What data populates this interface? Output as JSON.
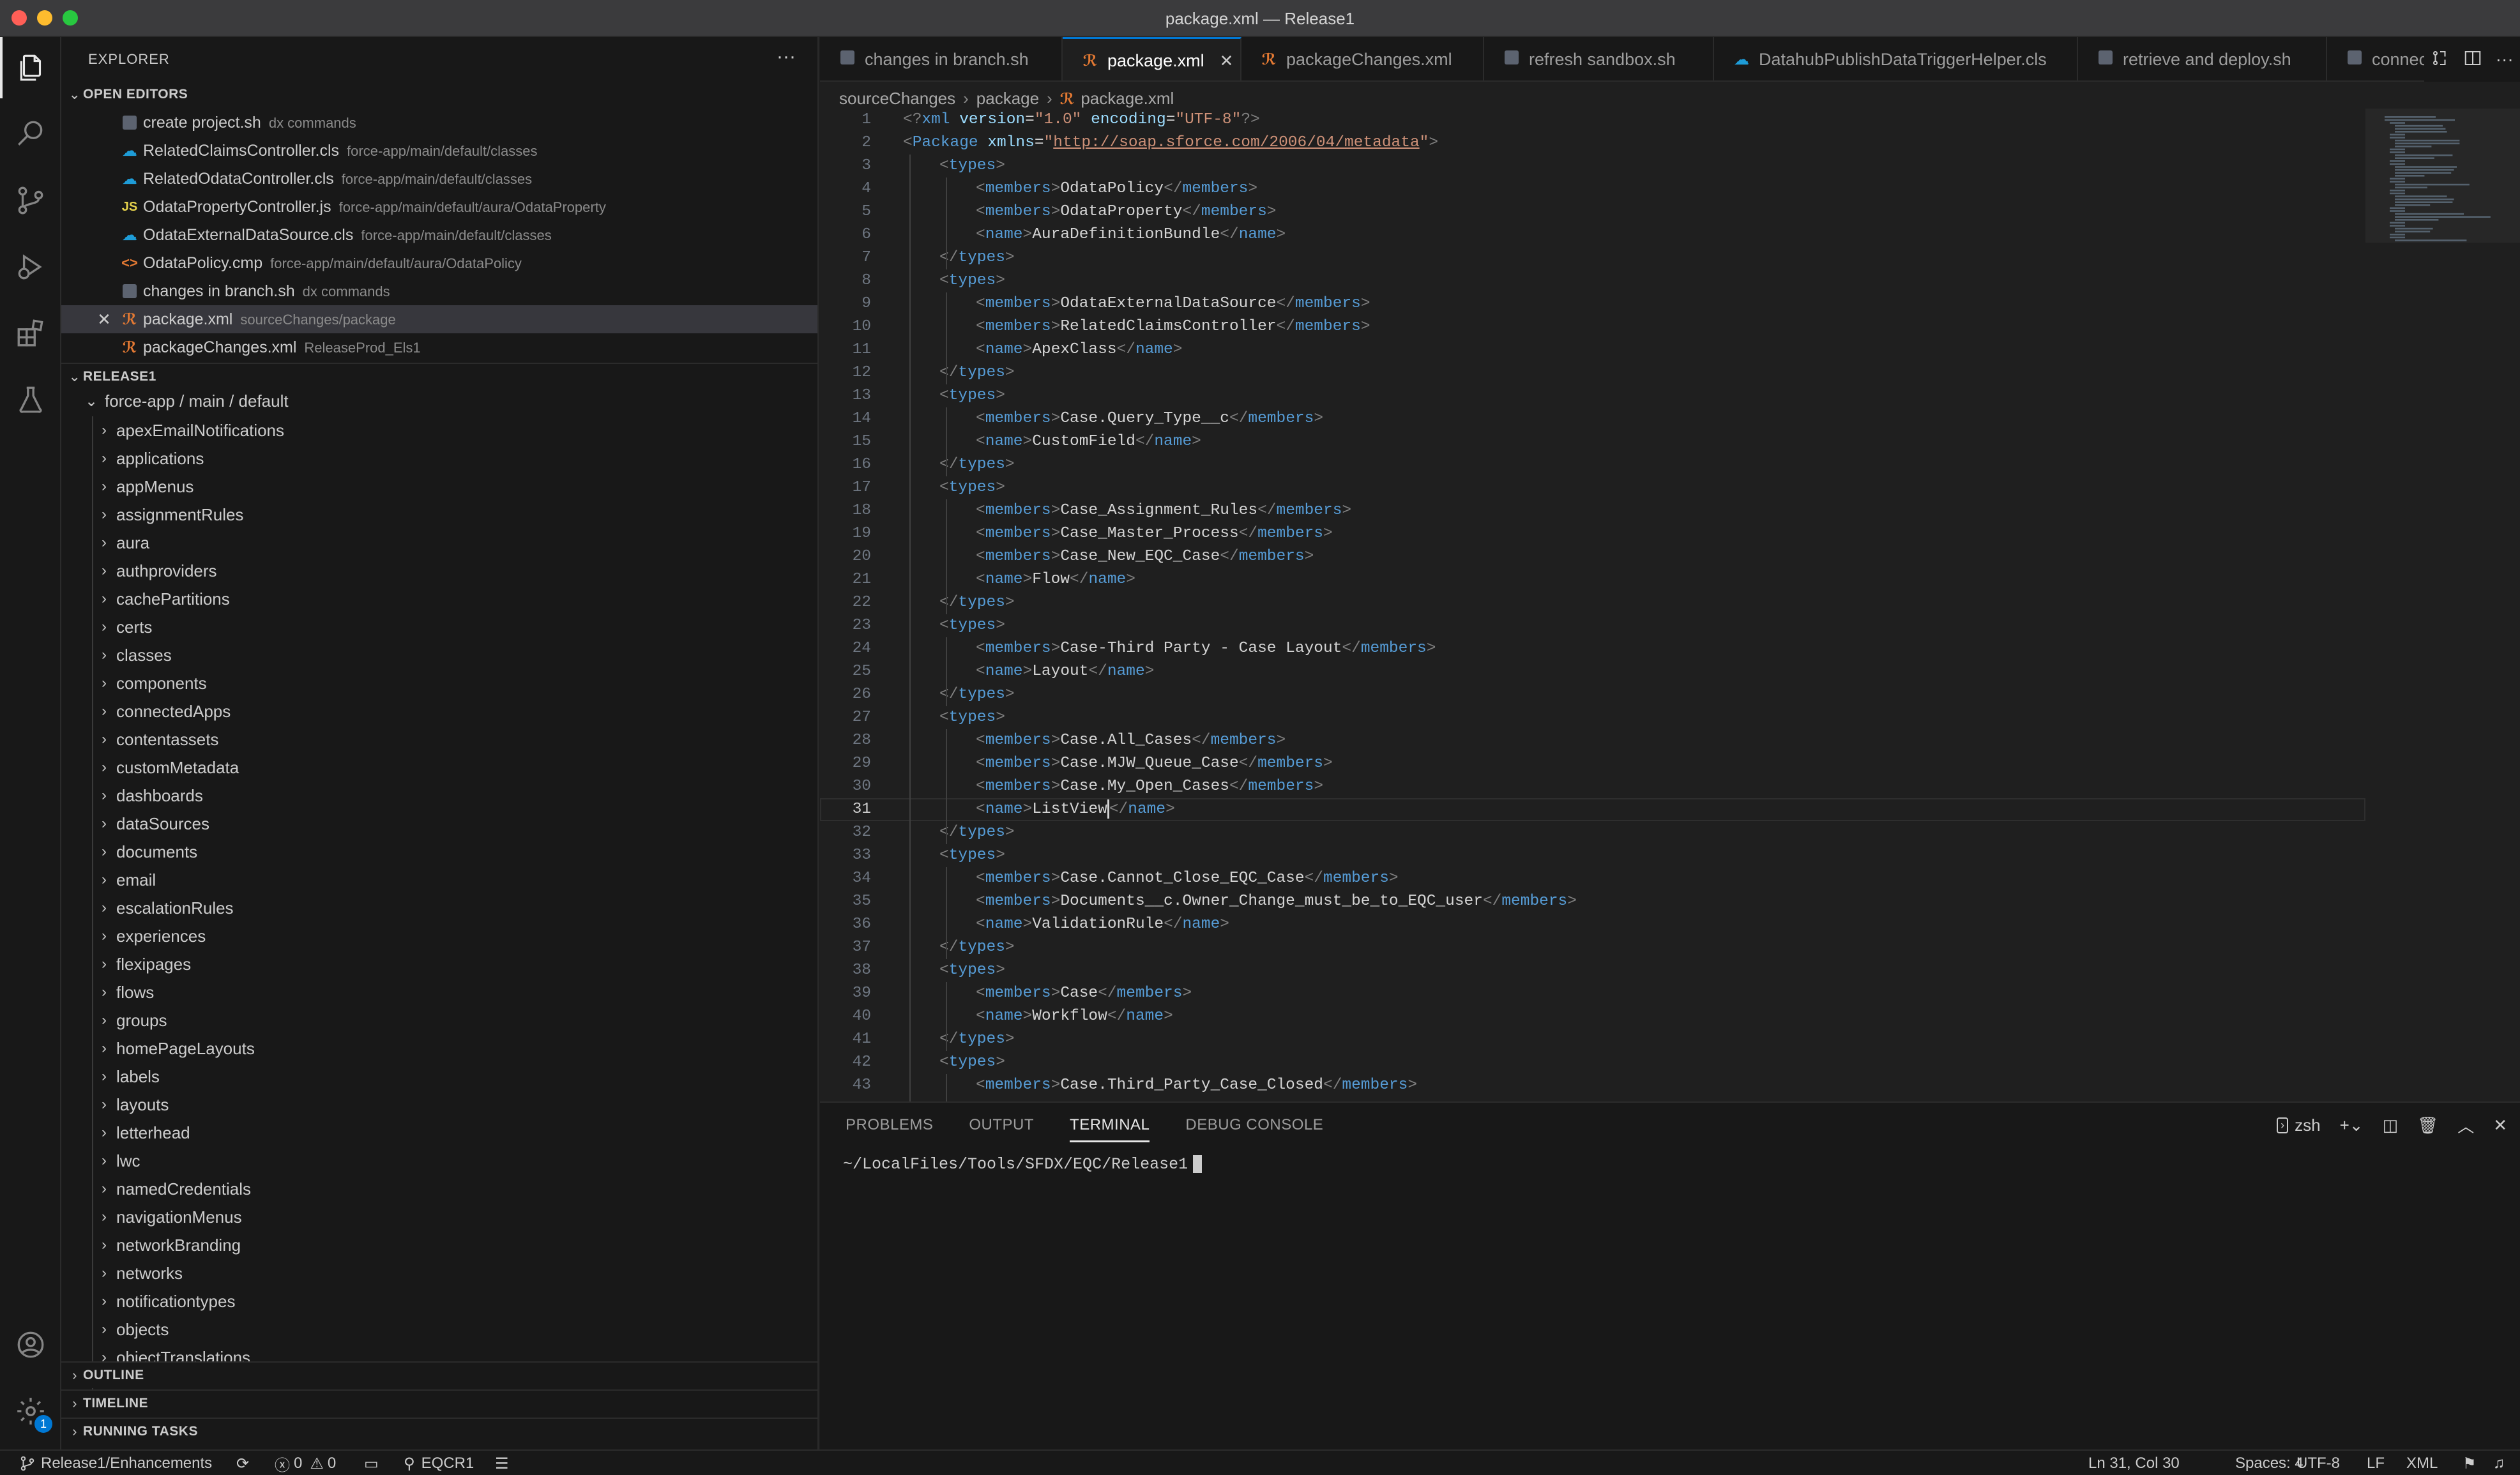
{
  "window": {
    "title": "package.xml — Release1"
  },
  "colors": {
    "accent": "#0078d4",
    "traffic_close": "#ff5f57",
    "traffic_min": "#febc2e",
    "traffic_max": "#28c840"
  },
  "activity_bar": {
    "items": [
      {
        "name": "explorer-icon",
        "active": true
      },
      {
        "name": "search-icon"
      },
      {
        "name": "source-control-icon"
      },
      {
        "name": "run-debug-icon"
      },
      {
        "name": "extensions-icon"
      },
      {
        "name": "testing-icon"
      }
    ],
    "bottom": [
      {
        "name": "accounts-icon"
      },
      {
        "name": "manage-gear-icon",
        "badge": "1"
      }
    ]
  },
  "explorer": {
    "title": "EXPLORER",
    "more": "···",
    "open_editors": {
      "label": "OPEN EDITORS",
      "items": [
        {
          "name": "create project.sh",
          "desc": "dx commands",
          "icon": "shell"
        },
        {
          "name": "RelatedClaimsController.cls",
          "desc": "force-app/main/default/classes",
          "icon": "salesforce"
        },
        {
          "name": "RelatedOdataController.cls",
          "desc": "force-app/main/default/classes",
          "icon": "salesforce"
        },
        {
          "name": "OdataPropertyController.js",
          "desc": "force-app/main/default/aura/OdataProperty",
          "icon": "js"
        },
        {
          "name": "OdataExternalDataSource.cls",
          "desc": "force-app/main/default/classes",
          "icon": "salesforce"
        },
        {
          "name": "OdataPolicy.cmp",
          "desc": "force-app/main/default/aura/OdataPolicy",
          "icon": "cmp"
        },
        {
          "name": "changes in branch.sh",
          "desc": "dx commands",
          "icon": "shell"
        },
        {
          "name": "package.xml",
          "desc": "sourceChanges/package",
          "icon": "rss",
          "selected": true,
          "close": "✕"
        },
        {
          "name": "packageChanges.xml",
          "desc": "ReleaseProd_Els1",
          "icon": "rss"
        }
      ]
    },
    "workspace": {
      "label": "RELEASE1",
      "root": "force-app / main / default",
      "folders": [
        "apexEmailNotifications",
        "applications",
        "appMenus",
        "assignmentRules",
        "aura",
        "authproviders",
        "cachePartitions",
        "certs",
        "classes",
        "components",
        "connectedApps",
        "contentassets",
        "customMetadata",
        "dashboards",
        "dataSources",
        "documents",
        "email",
        "escalationRules",
        "experiences",
        "flexipages",
        "flows",
        "groups",
        "homePageLayouts",
        "labels",
        "layouts",
        "letterhead",
        "lwc",
        "namedCredentials",
        "navigationMenus",
        "networkBranding",
        "networks",
        "notificationtypes",
        "objects",
        "objectTranslations"
      ]
    },
    "outline_label": "OUTLINE",
    "timeline_label": "TIMELINE",
    "running_tasks_label": "RUNNING TASKS"
  },
  "editor": {
    "tabs": [
      {
        "label": "changes in branch.sh",
        "icon": "shell"
      },
      {
        "label": "package.xml",
        "icon": "rss",
        "active": true,
        "close": "✕"
      },
      {
        "label": "packageChanges.xml",
        "icon": "rss"
      },
      {
        "label": "refresh sandbox.sh",
        "icon": "shell"
      },
      {
        "label": "DatahubPublishDataTriggerHelper.cls",
        "icon": "salesforce"
      },
      {
        "label": "retrieve and deploy.sh",
        "icon": "shell"
      },
      {
        "label": "connec",
        "icon": "shell"
      }
    ],
    "breadcrumb": [
      "sourceChanges",
      "package",
      "package.xml"
    ],
    "current_line": 31,
    "lines": [
      {
        "n": 1,
        "i": 0,
        "kind": "decl",
        "text": "<?xml version=\"1.0\" encoding=\"UTF-8\"?>"
      },
      {
        "n": 2,
        "i": 0,
        "kind": "pkg",
        "text": "<Package xmlns=\"http://soap.sforce.com/2006/04/metadata\">"
      },
      {
        "n": 3,
        "i": 1,
        "kind": "open",
        "tag": "types"
      },
      {
        "n": 4,
        "i": 2,
        "kind": "el",
        "tag": "members",
        "val": "OdataPolicy"
      },
      {
        "n": 5,
        "i": 2,
        "kind": "el",
        "tag": "members",
        "val": "OdataProperty"
      },
      {
        "n": 6,
        "i": 2,
        "kind": "el",
        "tag": "name",
        "val": "AuraDefinitionBundle"
      },
      {
        "n": 7,
        "i": 1,
        "kind": "close",
        "tag": "types"
      },
      {
        "n": 8,
        "i": 1,
        "kind": "open",
        "tag": "types"
      },
      {
        "n": 9,
        "i": 2,
        "kind": "el",
        "tag": "members",
        "val": "OdataExternalDataSource"
      },
      {
        "n": 10,
        "i": 2,
        "kind": "el",
        "tag": "members",
        "val": "RelatedClaimsController"
      },
      {
        "n": 11,
        "i": 2,
        "kind": "el",
        "tag": "name",
        "val": "ApexClass"
      },
      {
        "n": 12,
        "i": 1,
        "kind": "close",
        "tag": "types"
      },
      {
        "n": 13,
        "i": 1,
        "kind": "open",
        "tag": "types"
      },
      {
        "n": 14,
        "i": 2,
        "kind": "el",
        "tag": "members",
        "val": "Case.Query_Type__c"
      },
      {
        "n": 15,
        "i": 2,
        "kind": "el",
        "tag": "name",
        "val": "CustomField"
      },
      {
        "n": 16,
        "i": 1,
        "kind": "close",
        "tag": "types"
      },
      {
        "n": 17,
        "i": 1,
        "kind": "open",
        "tag": "types"
      },
      {
        "n": 18,
        "i": 2,
        "kind": "el",
        "tag": "members",
        "val": "Case_Assignment_Rules"
      },
      {
        "n": 19,
        "i": 2,
        "kind": "el",
        "tag": "members",
        "val": "Case_Master_Process"
      },
      {
        "n": 20,
        "i": 2,
        "kind": "el",
        "tag": "members",
        "val": "Case_New_EQC_Case"
      },
      {
        "n": 21,
        "i": 2,
        "kind": "el",
        "tag": "name",
        "val": "Flow"
      },
      {
        "n": 22,
        "i": 1,
        "kind": "close",
        "tag": "types"
      },
      {
        "n": 23,
        "i": 1,
        "kind": "open",
        "tag": "types"
      },
      {
        "n": 24,
        "i": 2,
        "kind": "el",
        "tag": "members",
        "val": "Case-Third Party - Case Layout"
      },
      {
        "n": 25,
        "i": 2,
        "kind": "el",
        "tag": "name",
        "val": "Layout"
      },
      {
        "n": 26,
        "i": 1,
        "kind": "close",
        "tag": "types"
      },
      {
        "n": 27,
        "i": 1,
        "kind": "open",
        "tag": "types"
      },
      {
        "n": 28,
        "i": 2,
        "kind": "el",
        "tag": "members",
        "val": "Case.All_Cases"
      },
      {
        "n": 29,
        "i": 2,
        "kind": "el",
        "tag": "members",
        "val": "Case.MJW_Queue_Case"
      },
      {
        "n": 30,
        "i": 2,
        "kind": "el",
        "tag": "members",
        "val": "Case.My_Open_Cases"
      },
      {
        "n": 31,
        "i": 2,
        "kind": "el",
        "tag": "name",
        "val": "ListView"
      },
      {
        "n": 32,
        "i": 1,
        "kind": "close",
        "tag": "types"
      },
      {
        "n": 33,
        "i": 1,
        "kind": "open",
        "tag": "types"
      },
      {
        "n": 34,
        "i": 2,
        "kind": "el",
        "tag": "members",
        "val": "Case.Cannot_Close_EQC_Case"
      },
      {
        "n": 35,
        "i": 2,
        "kind": "el",
        "tag": "members",
        "val": "Documents__c.Owner_Change_must_be_to_EQC_user"
      },
      {
        "n": 36,
        "i": 2,
        "kind": "el",
        "tag": "name",
        "val": "ValidationRule"
      },
      {
        "n": 37,
        "i": 1,
        "kind": "close",
        "tag": "types"
      },
      {
        "n": 38,
        "i": 1,
        "kind": "open",
        "tag": "types"
      },
      {
        "n": 39,
        "i": 2,
        "kind": "el",
        "tag": "members",
        "val": "Case"
      },
      {
        "n": 40,
        "i": 2,
        "kind": "el",
        "tag": "name",
        "val": "Workflow"
      },
      {
        "n": 41,
        "i": 1,
        "kind": "close",
        "tag": "types"
      },
      {
        "n": 42,
        "i": 1,
        "kind": "open",
        "tag": "types"
      },
      {
        "n": 43,
        "i": 2,
        "kind": "el",
        "tag": "members",
        "val": "Case.Third_Party_Case_Closed"
      }
    ]
  },
  "panel": {
    "tabs": [
      {
        "label": "PROBLEMS"
      },
      {
        "label": "OUTPUT"
      },
      {
        "label": "TERMINAL",
        "active": true
      },
      {
        "label": "DEBUG CONSOLE"
      }
    ],
    "shell": "zsh",
    "prompt": "~/LocalFiles/Tools/SFDX/EQC/Release1"
  },
  "statusbar": {
    "branch": "Release1/Enhancements",
    "errors": "0",
    "warnings": "0",
    "org": "EQCR1",
    "position": "Ln 31, Col 30",
    "spaces": "Spaces: 4",
    "encoding": "UTF-8",
    "eol": "LF",
    "language": "XML"
  }
}
